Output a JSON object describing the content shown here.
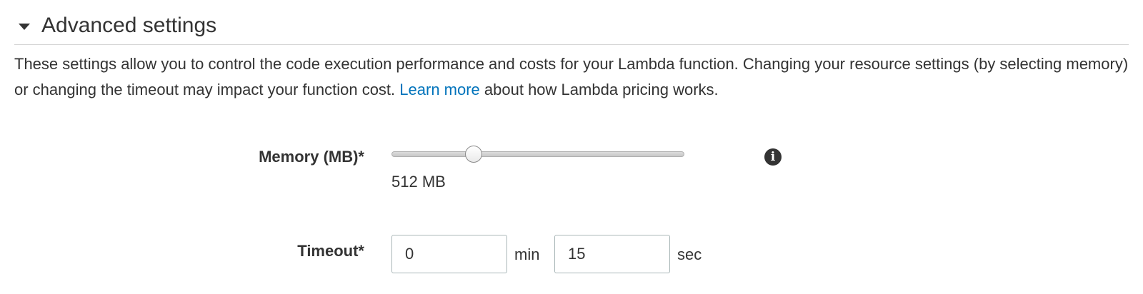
{
  "section": {
    "title": "Advanced settings",
    "expanded": true,
    "description_before": "These settings allow you to control the code execution performance and costs for your Lambda function. Changing your resource settings (by selecting memory) or changing the timeout may impact your function cost. ",
    "link_text": "Learn more",
    "description_after": " about how Lambda pricing works.",
    "link_color": "#0073bb"
  },
  "memory": {
    "label": "Memory (MB)*",
    "value_text": "512 MB",
    "slider_fraction": 0.28,
    "info_icon": "info-icon"
  },
  "timeout": {
    "label": "Timeout*",
    "minutes_value": "0",
    "minutes_unit": "min",
    "seconds_value": "15",
    "seconds_unit": "sec"
  }
}
